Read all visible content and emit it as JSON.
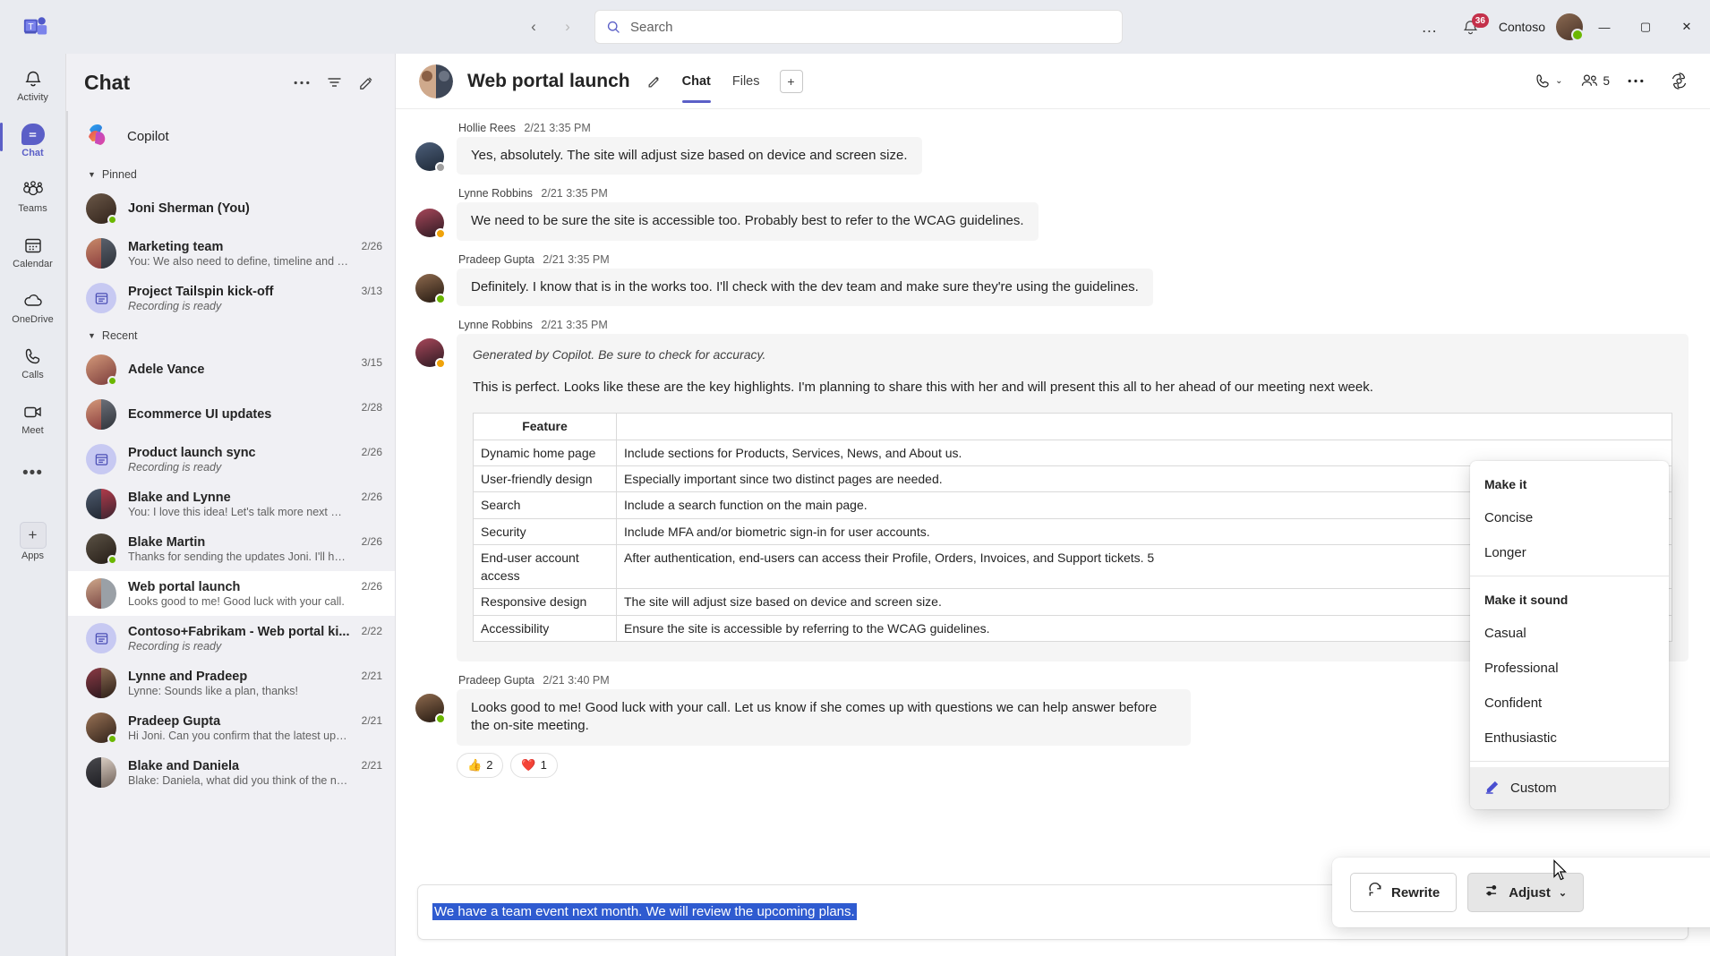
{
  "titlebar": {
    "app_logo": "teams-logo",
    "back_label": "‹",
    "forward_label": "›",
    "search_placeholder": "Search",
    "more_label": "…",
    "notification_count": "36",
    "org_name": "Contoso",
    "minimize": "—",
    "maximize": "▢",
    "close": "✕"
  },
  "rail": {
    "items": [
      {
        "label": "Activity",
        "icon": "bell-icon",
        "active": false
      },
      {
        "label": "Chat",
        "icon": "chat-icon",
        "active": true
      },
      {
        "label": "Teams",
        "icon": "teams-icon",
        "active": false
      },
      {
        "label": "Calendar",
        "icon": "calendar-icon",
        "active": false
      },
      {
        "label": "OneDrive",
        "icon": "cloud-icon",
        "active": false
      },
      {
        "label": "Calls",
        "icon": "phone-icon",
        "active": false
      },
      {
        "label": "Meet",
        "icon": "video-icon",
        "active": false
      }
    ],
    "more_label": "•••",
    "apps_label": "Apps"
  },
  "chatlist": {
    "title": "Chat",
    "more_icon": "more-horizontal-icon",
    "filter_icon": "filter-icon",
    "compose_icon": "compose-icon",
    "copilot": {
      "label": "Copilot",
      "icon": "copilot-icon"
    },
    "groups": [
      {
        "label": "Pinned",
        "items": [
          {
            "name": "Joni Sherman (You)",
            "preview": "",
            "time": "",
            "presence": "avail",
            "avatar": "person",
            "selected": false
          },
          {
            "name": "Marketing team",
            "preview": "You: We also need to define, timeline and miles...",
            "time": "2/26",
            "presence": "",
            "avatar": "group",
            "selected": false
          },
          {
            "name": "Project Tailspin kick-off",
            "preview": "Recording is ready",
            "time": "3/13",
            "presence": "",
            "avatar": "meeting",
            "selected": false,
            "italic": true
          }
        ]
      },
      {
        "label": "Recent",
        "items": [
          {
            "name": "Adele Vance",
            "preview": "",
            "time": "3/15",
            "presence": "avail",
            "avatar": "person2",
            "selected": false
          },
          {
            "name": "Ecommerce UI updates",
            "preview": "",
            "time": "2/28",
            "presence": "",
            "avatar": "group",
            "selected": false
          },
          {
            "name": "Product launch sync",
            "preview": "Recording is ready",
            "time": "2/26",
            "presence": "",
            "avatar": "meeting",
            "selected": false,
            "italic": true
          },
          {
            "name": "Blake and Lynne",
            "preview": "You: I love this idea! Let's talk more next week.",
            "time": "2/26",
            "presence": "",
            "avatar": "group2",
            "selected": false
          },
          {
            "name": "Blake Martin",
            "preview": "Thanks for sending the updates Joni. I'll have s...",
            "time": "2/26",
            "presence": "avail",
            "avatar": "person3",
            "selected": false
          },
          {
            "name": "Web portal launch",
            "preview": "Looks good to me! Good luck with your call.",
            "time": "2/26",
            "presence": "",
            "avatar": "group3",
            "selected": true
          },
          {
            "name": "Contoso+Fabrikam - Web portal ki...",
            "preview": "Recording is ready",
            "time": "2/22",
            "presence": "",
            "avatar": "meeting",
            "selected": false,
            "italic": true
          },
          {
            "name": "Lynne and Pradeep",
            "preview": "Lynne: Sounds like a plan, thanks!",
            "time": "2/21",
            "presence": "",
            "avatar": "group4",
            "selected": false
          },
          {
            "name": "Pradeep Gupta",
            "preview": "Hi Joni. Can you confirm that the latest updates...",
            "time": "2/21",
            "presence": "avail",
            "avatar": "person4",
            "selected": false
          },
          {
            "name": "Blake and Daniela",
            "preview": "Blake: Daniela, what did you think of the new d...",
            "time": "2/21",
            "presence": "",
            "avatar": "group5",
            "selected": false
          }
        ]
      }
    ]
  },
  "conversation": {
    "title": "Web portal launch",
    "edit_icon": "pencil-icon",
    "tabs": [
      {
        "label": "Chat",
        "active": true
      },
      {
        "label": "Files",
        "active": false
      }
    ],
    "add_tab_label": "+",
    "header_actions": {
      "call_icon": "call-icon",
      "call_chevron": "⌄",
      "people_icon": "people-icon",
      "people_count": "5",
      "more_icon": "more-horizontal-icon",
      "copilot_icon": "copilot-icon"
    },
    "messages": [
      {
        "author": "Hollie Rees",
        "time": "2/21 3:35 PM",
        "text": "Yes, absolutely. The site will adjust size based on device and screen size.",
        "presence": "gray",
        "avatar": "hollie"
      },
      {
        "author": "Lynne Robbins",
        "time": "2/21 3:35 PM",
        "text": "We need to be sure the site is accessible too. Probably best to refer to the WCAG guidelines.",
        "presence": "amber",
        "avatar": "lynne"
      },
      {
        "author": "Pradeep Gupta",
        "time": "2/21 3:35 PM",
        "text": "Definitely. I know that is in the works too. I'll check with the dev team and make sure they're using the guidelines.",
        "presence": "green",
        "avatar": "pradeep"
      }
    ],
    "copilot_message": {
      "author": "Lynne Robbins",
      "time": "2/21 3:35 PM",
      "presence": "amber",
      "disclaimer": "Generated by Copilot. Be sure to check for accuracy.",
      "paragraph": "This is perfect. Looks like these are the key highlights. I'm planning to share this with her and will present this all to her ahead of our meeting next week.",
      "table": {
        "headers": [
          "Feature",
          ""
        ],
        "rows": [
          [
            "Dynamic home page",
            "Include sections for Products, Services, News, and About us."
          ],
          [
            "User-friendly design",
            "Especially important since two distinct pages are needed."
          ],
          [
            "Search",
            "Include a search function on the main page."
          ],
          [
            "Security",
            "Include MFA and/or biometric sign-in for user accounts."
          ],
          [
            "End-user account access",
            "After authentication, end-users can access their Profile, Orders, Invoices, and Support tickets. 5"
          ],
          [
            "Responsive design",
            "The site will adjust size based on device and screen size."
          ],
          [
            "Accessibility",
            "Ensure the site is accessible by referring to the WCAG guidelines."
          ]
        ],
        "citation": "5"
      }
    },
    "last_message": {
      "author": "Pradeep Gupta",
      "time": "2/21 3:40 PM",
      "presence": "green",
      "avatar": "pradeep",
      "text": "Looks good to me! Good luck with your call. Let us know if she comes up with questions we can help answer before the on-site meeting.",
      "reactions": [
        {
          "emoji": "👍",
          "count": "2"
        },
        {
          "emoji": "❤️",
          "count": "1"
        }
      ]
    }
  },
  "rewrite_toolbar": {
    "rewrite_label": "Rewrite",
    "rewrite_icon": "refresh-icon",
    "adjust_label": "Adjust",
    "adjust_icon": "sliders-icon",
    "adjust_chevron": "⌄",
    "close_icon": "close-icon"
  },
  "adjust_dropdown": {
    "section_1_title": "Make it",
    "section_1_items": [
      "Concise",
      "Longer"
    ],
    "section_2_title": "Make it sound",
    "section_2_items": [
      "Casual",
      "Professional",
      "Confident",
      "Enthusiastic"
    ],
    "custom_label": "Custom",
    "custom_icon": "pen-highlight-icon"
  },
  "composer": {
    "text": "We have a team event next month. We will review the upcoming plans.",
    "icons": [
      {
        "name": "format-icon",
        "glyph": "A"
      },
      {
        "name": "emoji-icon",
        "glyph": "☺"
      },
      {
        "name": "copilot-icon",
        "glyph": "✦"
      },
      {
        "name": "sticker-icon",
        "glyph": "◎"
      },
      {
        "name": "plus-icon",
        "glyph": "+"
      },
      {
        "name": "send-icon",
        "glyph": "➢"
      }
    ]
  },
  "colors": {
    "accent": "#5b5fc7",
    "badge_red": "#c4314b",
    "presence_green": "#6bb700",
    "selection_blue": "#2f5bd0"
  }
}
